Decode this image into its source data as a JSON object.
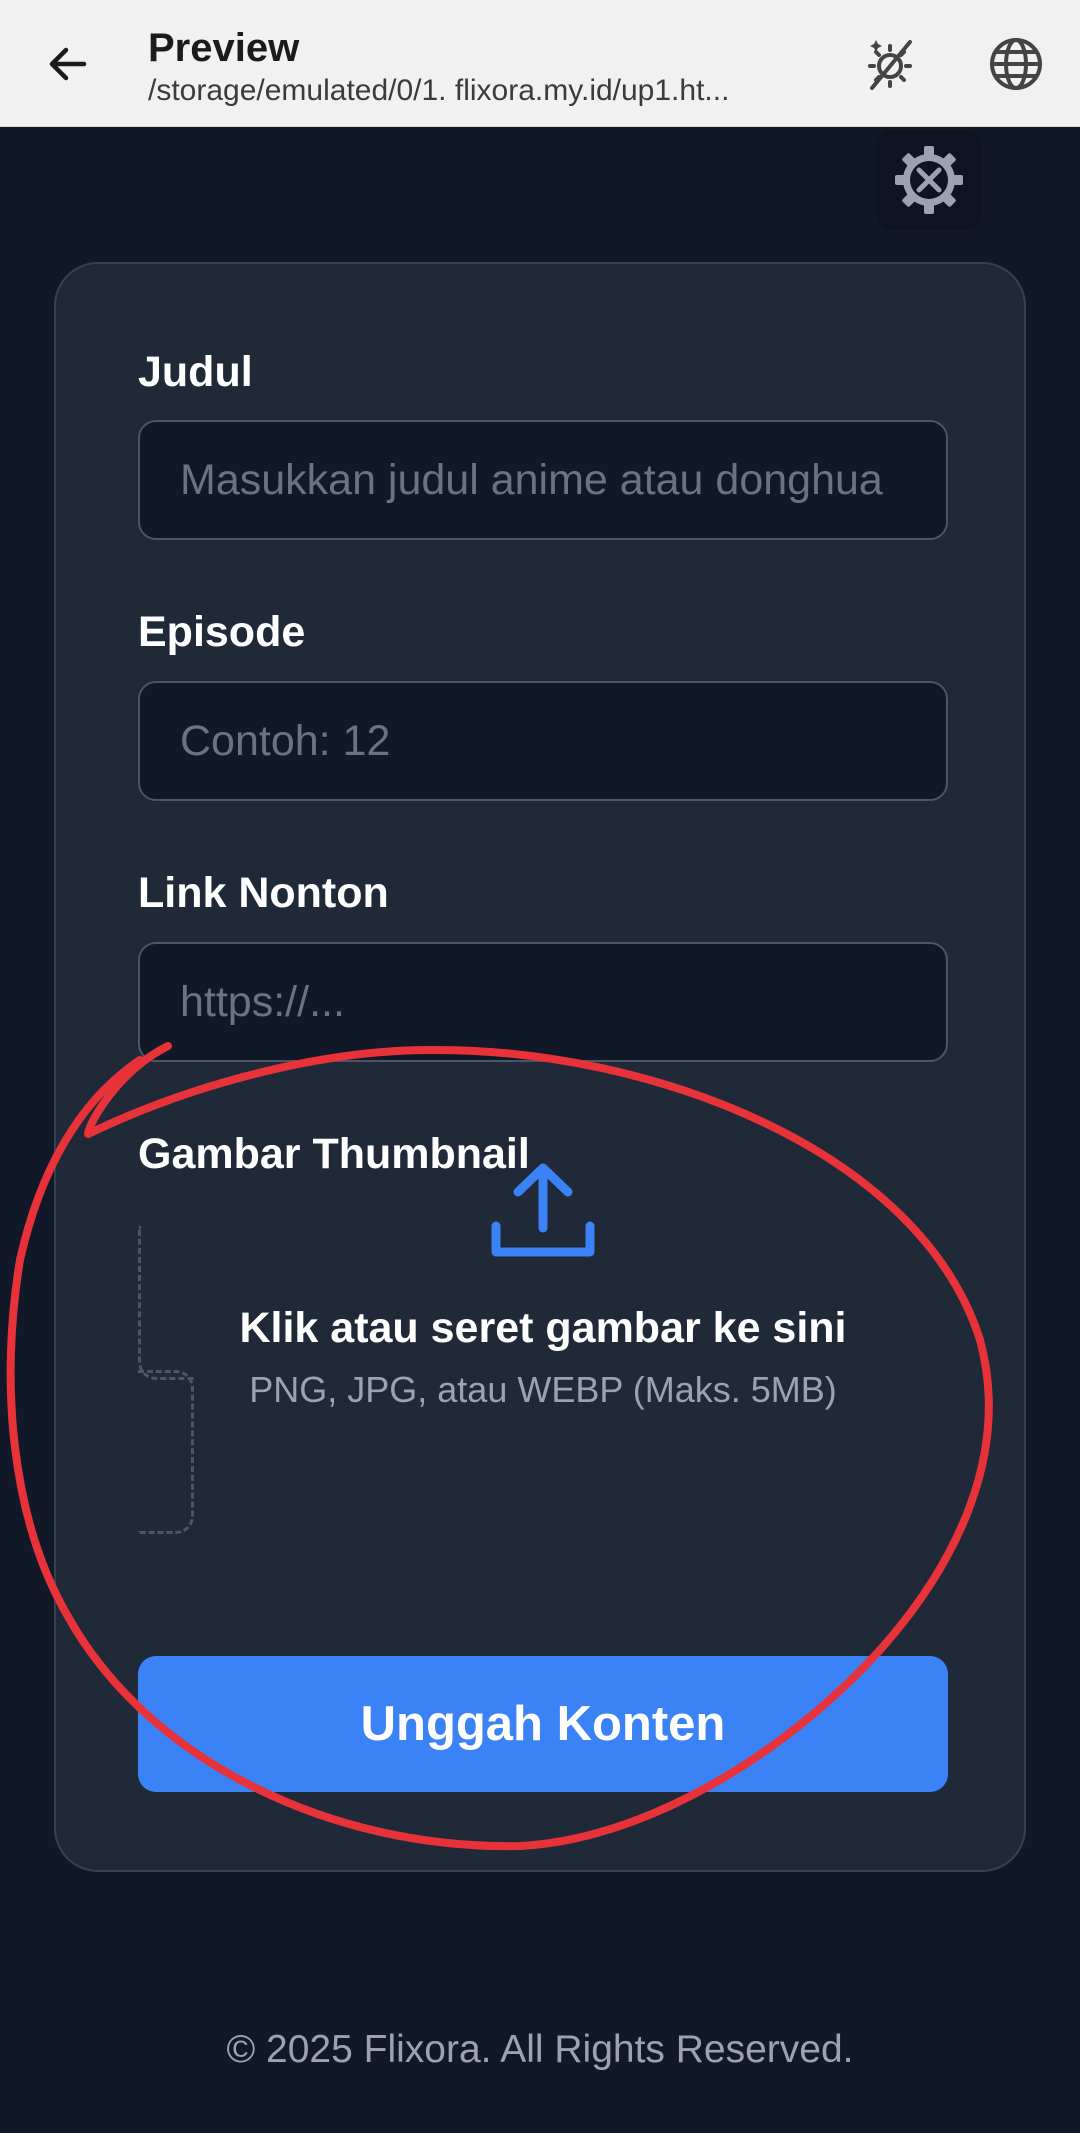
{
  "appbar": {
    "title": "Preview",
    "subtitle": "/storage/emulated/0/1. flixora.my.id/up1.ht..."
  },
  "form": {
    "judul": {
      "label": "Judul",
      "placeholder": "Masukkan judul anime atau donghua"
    },
    "episode": {
      "label": "Episode",
      "placeholder": "Contoh: 12"
    },
    "link": {
      "label": "Link Nonton",
      "placeholder": "https://..."
    },
    "thumbnail": {
      "label": "Gambar Thumbnail",
      "drop_title": "Klik atau seret gambar ke sini",
      "drop_hint": "PNG, JPG, atau WEBP (Maks. 5MB)"
    },
    "submit_label": "Unggah Konten"
  },
  "footer": {
    "text": "© 2025 Flixora. All Rights Reserved."
  },
  "colors": {
    "background": "#111827",
    "card": "#1f2937",
    "accent": "#3b82f6",
    "annotation": "#e8323a"
  },
  "icons": [
    "back-arrow-icon",
    "dark-mode-icon",
    "globe-icon",
    "settings-gear-icon",
    "upload-icon"
  ]
}
